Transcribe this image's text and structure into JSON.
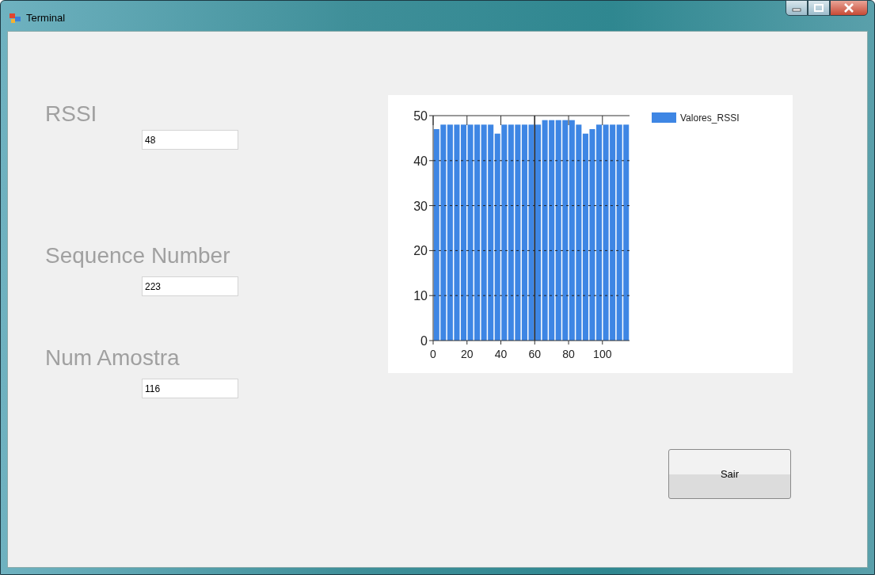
{
  "window": {
    "title": "Terminal"
  },
  "fields": [
    {
      "label": "RSSI",
      "value": "48"
    },
    {
      "label": "Sequence Number",
      "value": "223"
    },
    {
      "label": "Num Amostra",
      "value": "116"
    }
  ],
  "chart": {
    "chart_data": {
      "type": "bar",
      "x": [
        2,
        6,
        10,
        14,
        18,
        22,
        26,
        30,
        34,
        38,
        42,
        46,
        50,
        54,
        58,
        62,
        66,
        70,
        74,
        78,
        82,
        86,
        90,
        94,
        98,
        102,
        106,
        110,
        114
      ],
      "series": [
        {
          "name": "Valores_RSSI",
          "color": "#3e86e4",
          "values": [
            47,
            48,
            48,
            48,
            48,
            48,
            48,
            48,
            48,
            46,
            48,
            48,
            48,
            48,
            48,
            48,
            49,
            49,
            49,
            49,
            49,
            48,
            46,
            47,
            48,
            48,
            48,
            48,
            48
          ]
        }
      ],
      "xlim": [
        0,
        116
      ],
      "grid": true,
      "ref_lines": [
        {
          "axis": "x",
          "value": 60
        }
      ],
      "ylim": [
        0,
        50
      ],
      "xticks": [
        0,
        20,
        40,
        60,
        80,
        100
      ],
      "yticks": [
        0,
        10,
        20,
        30,
        40,
        50
      ]
    }
  },
  "button": {
    "label": "Sair"
  }
}
